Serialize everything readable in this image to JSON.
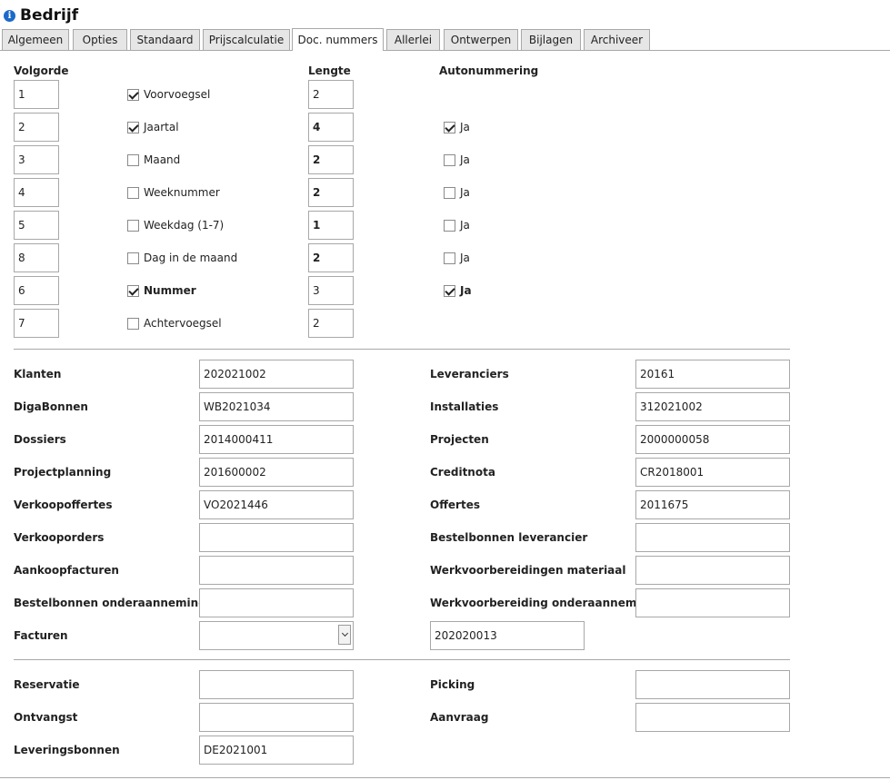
{
  "header": {
    "title": "Bedrijf",
    "icon": "info-icon"
  },
  "tabs": [
    {
      "label": "Algemeen",
      "active": false
    },
    {
      "label": "Opties",
      "active": false
    },
    {
      "label": "Standaard",
      "active": false
    },
    {
      "label": "Prijscalculatie",
      "active": false
    },
    {
      "label": "Doc. nummers",
      "active": true
    },
    {
      "label": "Allerlei",
      "active": false
    },
    {
      "label": "Ontwerpen",
      "active": false
    },
    {
      "label": "Bijlagen",
      "active": false
    },
    {
      "label": "Archiveer",
      "active": false
    }
  ],
  "sequence": {
    "headers": {
      "order": "Volgorde",
      "length": "Lengte",
      "auto": "Autonummering"
    },
    "rows": [
      {
        "order": "1",
        "name": "Voorvoegsel",
        "checked": true,
        "length": "2",
        "auto_label": ""
      },
      {
        "order": "2",
        "name": "Jaartal",
        "checked": true,
        "length": "4",
        "auto_label": "Ja",
        "auto_checked": true
      },
      {
        "order": "3",
        "name": "Maand",
        "checked": false,
        "length": "2",
        "auto_label": "Ja",
        "auto_checked": false
      },
      {
        "order": "4",
        "name": "Weeknummer",
        "checked": false,
        "length": "2",
        "auto_label": "Ja",
        "auto_checked": false
      },
      {
        "order": "5",
        "name": "Weekdag (1-7)",
        "checked": false,
        "length": "1",
        "auto_label": "Ja",
        "auto_checked": false
      },
      {
        "order": "8",
        "name": "Dag in de maand",
        "checked": false,
        "length": "2",
        "auto_label": "Ja",
        "auto_checked": false
      },
      {
        "order": "6",
        "name": "Nummer",
        "checked": true,
        "length": "3",
        "auto_label": "Ja",
        "auto_checked": true
      },
      {
        "order": "7",
        "name": "Achtervoegsel",
        "checked": false,
        "length": "2",
        "auto_label": ""
      }
    ]
  },
  "numbers": {
    "left": [
      {
        "label": "Klanten",
        "value": "202021002"
      },
      {
        "label": "DigaBonnen",
        "value": "WB2021034"
      },
      {
        "label": "Dossiers",
        "value": "2014000411"
      },
      {
        "label": "Projectplanning",
        "value": "201600002"
      },
      {
        "label": "Verkoopoffertes",
        "value": "VO2021446"
      },
      {
        "label": "Verkooporders",
        "value": ""
      },
      {
        "label": "Aankoopfacturen",
        "value": ""
      },
      {
        "label": "Bestelbonnen onderaanneming",
        "value": ""
      },
      {
        "label": "Facturen",
        "value": ""
      }
    ],
    "right": [
      {
        "label": "Leveranciers",
        "value": "20161"
      },
      {
        "label": "Installaties",
        "value": "312021002"
      },
      {
        "label": "Projecten",
        "value": "2000000058"
      },
      {
        "label": "Creditnota",
        "value": "CR2018001"
      },
      {
        "label": "Offertes",
        "value": "2011675"
      },
      {
        "label": "Bestelbonnen leverancier",
        "value": ""
      },
      {
        "label": "Werkvoorbereidingen materiaal",
        "value": ""
      },
      {
        "label": "Werkvoorbereiding onderaanneming",
        "value": ""
      }
    ],
    "invoice_number": "202020013"
  },
  "extra": {
    "left": [
      {
        "label": "Reservatie",
        "value": ""
      },
      {
        "label": "Ontvangst",
        "value": ""
      },
      {
        "label": "Leveringsbonnen",
        "value": "DE2021001"
      }
    ],
    "right": [
      {
        "label": "Picking",
        "value": ""
      },
      {
        "label": "Aanvraag",
        "value": ""
      }
    ]
  }
}
